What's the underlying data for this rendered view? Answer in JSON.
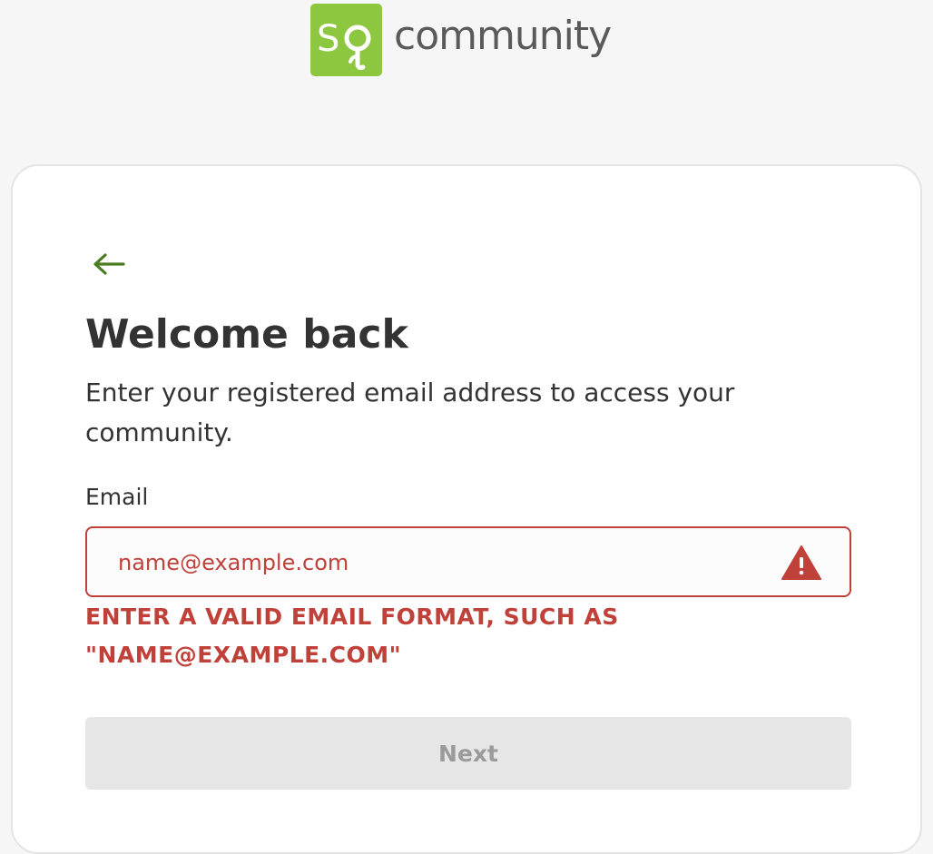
{
  "brand": {
    "logo_icon": "sq-logo-icon",
    "name": "community",
    "logo_color": "#8dc63f"
  },
  "card": {
    "back_icon": "arrow-left-icon",
    "title": "Welcome back",
    "subtitle": "Enter your registered email address to access your community.",
    "email": {
      "label": "Email",
      "value": "",
      "placeholder": "name@example.com",
      "state": "error",
      "error_icon": "warning-triangle-icon",
      "error_message": "ENTER A VALID EMAIL FORMAT, SUCH AS \"NAME@EXAMPLE.COM\""
    },
    "next_button": {
      "label": "Next",
      "disabled": true
    }
  },
  "colors": {
    "accent_green": "#4a7c22",
    "error_red": "#c0413a",
    "disabled_bg": "#e6e6e6"
  }
}
